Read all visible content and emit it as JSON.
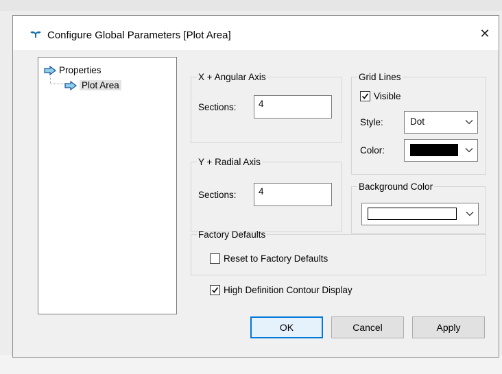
{
  "window": {
    "title": "Configure Global Parameters [Plot Area]",
    "close_glyph": "✕"
  },
  "tree": {
    "items": [
      {
        "label": "Properties",
        "icon": "right-arrow-icon"
      },
      {
        "label": "Plot Area",
        "icon": "right-arrow-icon",
        "selected": true
      }
    ]
  },
  "x_axis": {
    "legend": "X + Angular Axis",
    "sections_label": "Sections:",
    "sections_value": "4"
  },
  "y_axis": {
    "legend": "Y + Radial Axis",
    "sections_label": "Sections:",
    "sections_value": "4"
  },
  "grid_lines": {
    "legend": "Grid Lines",
    "visible_label": "Visible",
    "visible_checked": true,
    "style_label": "Style:",
    "style_value": "Dot",
    "color_label": "Color:",
    "color_value": "#000000"
  },
  "background_color": {
    "legend": "Background Color",
    "color_value": "#ffffff"
  },
  "factory_defaults": {
    "legend": "Factory Defaults",
    "reset_label": "Reset to Factory Defaults",
    "reset_checked": false
  },
  "high_def": {
    "label": "High Definition Contour Display",
    "checked": true
  },
  "buttons": {
    "ok": "OK",
    "cancel": "Cancel",
    "apply": "Apply"
  },
  "colors": {
    "accent": "#0078d7",
    "arrow_fill": "#8ecfe8",
    "arrow_stroke": "#1a4fa0"
  }
}
